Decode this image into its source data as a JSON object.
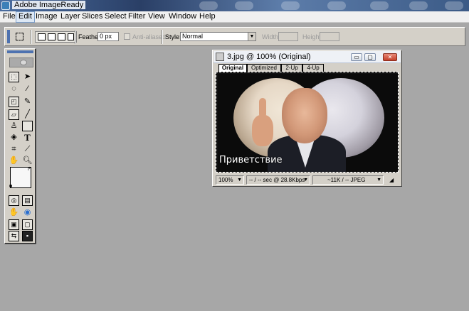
{
  "app": {
    "title": "Adobe ImageReady"
  },
  "menu": {
    "items": [
      "File",
      "Edit",
      "Image",
      "Layer",
      "Slices",
      "Select",
      "Filter",
      "View",
      "Window",
      "Help"
    ],
    "active_item": "Edit"
  },
  "options_bar": {
    "feather_label": "Feather:",
    "feather_value": "0 px",
    "anti_aliased_label": "Anti-aliased",
    "style_label": "Style:",
    "style_value": "Normal",
    "width_label": "Width:",
    "height_label": "Height:"
  },
  "document": {
    "title": "3.jpg @ 100% (Original)",
    "tabs": [
      "Original",
      "Optimized",
      "2-Up",
      "4-Up"
    ],
    "active_tab": "Original",
    "caption": "Приветствие",
    "status": {
      "zoom": "100%",
      "speed": "-- / -- sec @ 28.8Kbps",
      "size": "~11K / -- JPEG"
    },
    "window_buttons": {
      "minimize": "▭",
      "maximize": "▢",
      "close": "✕"
    }
  },
  "toolbox": {
    "tools": [
      "rectangular-marquee",
      "move",
      "lasso",
      "magic-wand",
      "slice",
      "slice-select",
      "eraser",
      "brush",
      "rubber-stamp",
      "rectangle",
      "paint-bucket",
      "type",
      "crop",
      "eyedropper",
      "hand",
      "zoom",
      "image-map",
      "image-map-select",
      "jump-to-photoshop",
      "preview-in-browser"
    ]
  }
}
